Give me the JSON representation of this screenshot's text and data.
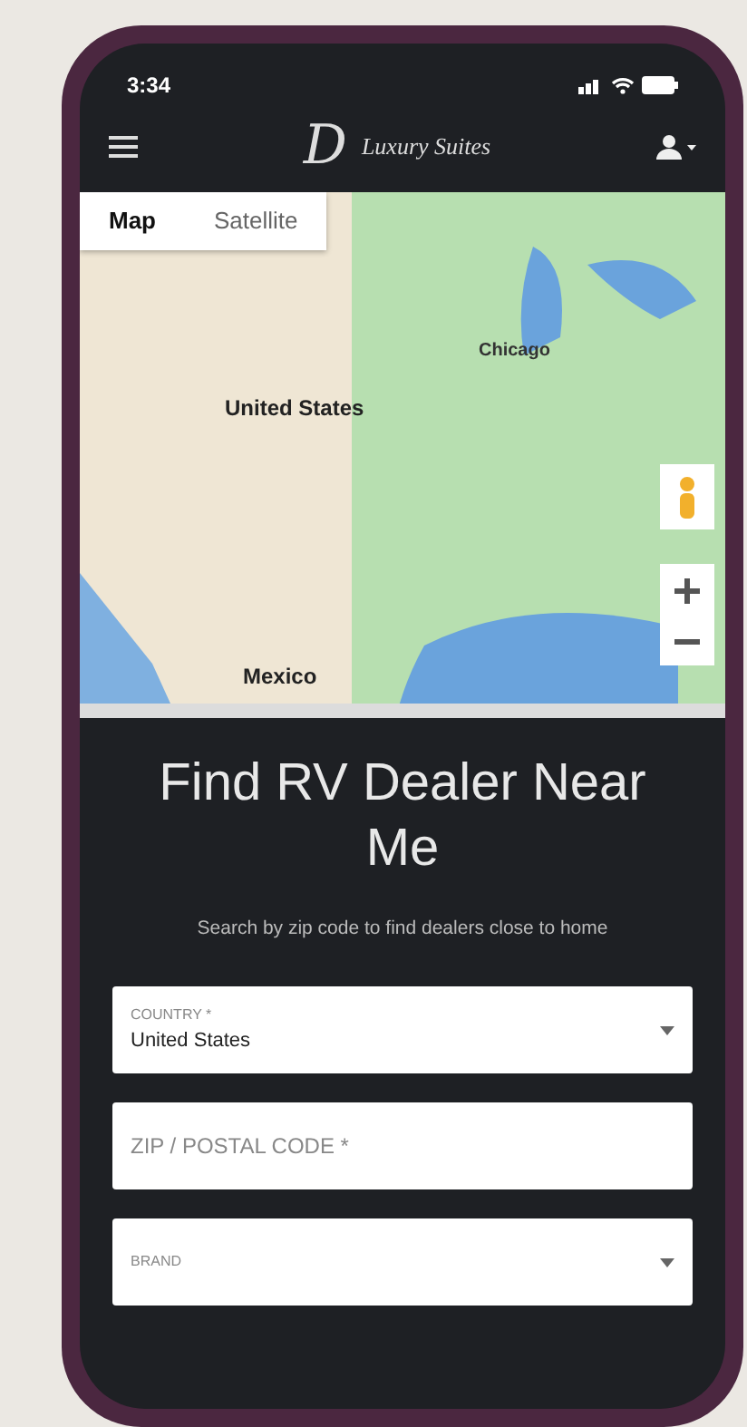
{
  "status_bar": {
    "time": "3:34"
  },
  "header": {
    "brand_mark": "D",
    "brand_name": "Luxury Suites"
  },
  "map": {
    "tabs": [
      {
        "label": "Map",
        "selected": true
      },
      {
        "label": "Satellite",
        "selected": false
      }
    ],
    "labels": [
      {
        "text": "Chicago",
        "kind": "city"
      },
      {
        "text": "United States",
        "kind": "country"
      },
      {
        "text": "Mexico",
        "kind": "country"
      }
    ]
  },
  "finder": {
    "title": "Find RV Dealer Near Me",
    "subtitle": "Search by zip code to find dealers close to home",
    "fields": [
      {
        "kind": "select",
        "label": "COUNTRY *",
        "value": "United States"
      },
      {
        "kind": "text",
        "placeholder": "ZIP / POSTAL CODE *"
      },
      {
        "kind": "select",
        "label": "BRAND"
      }
    ]
  }
}
